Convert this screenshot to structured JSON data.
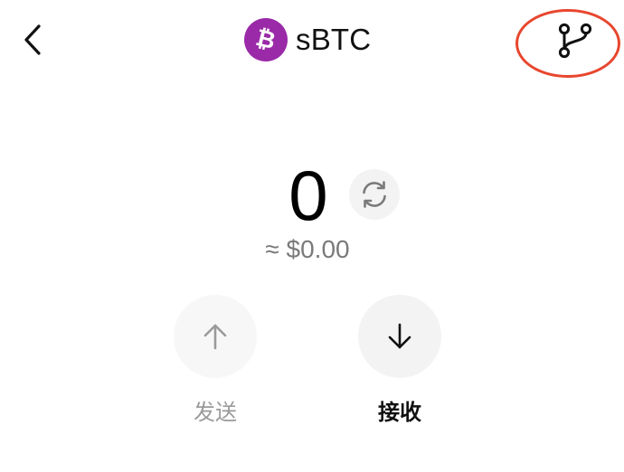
{
  "header": {
    "title": "sBTC",
    "coin_symbol": "₿",
    "coin_color": "#9a2aa8",
    "back_icon": "chevron-left-icon",
    "branch_icon": "git-branch-icon",
    "highlight_color": "#e8462e"
  },
  "balance": {
    "amount": "0",
    "fiat": "≈ $0.00",
    "refresh_icon": "refresh-icon"
  },
  "actions": {
    "send": {
      "label": "发送",
      "icon": "arrow-up-icon",
      "enabled": false
    },
    "receive": {
      "label": "接收",
      "icon": "arrow-down-icon",
      "enabled": true
    }
  }
}
